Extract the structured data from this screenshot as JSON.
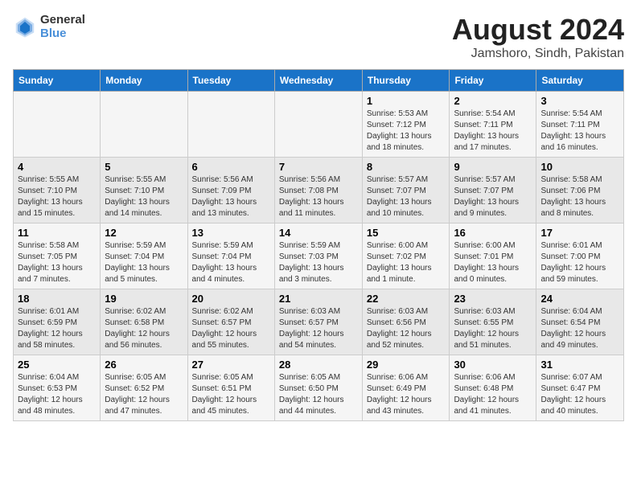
{
  "header": {
    "logo_line1": "General",
    "logo_line2": "Blue",
    "title": "August 2024",
    "subtitle": "Jamshoro, Sindh, Pakistan"
  },
  "days_of_week": [
    "Sunday",
    "Monday",
    "Tuesday",
    "Wednesday",
    "Thursday",
    "Friday",
    "Saturday"
  ],
  "weeks": [
    [
      {
        "day": "",
        "info": ""
      },
      {
        "day": "",
        "info": ""
      },
      {
        "day": "",
        "info": ""
      },
      {
        "day": "",
        "info": ""
      },
      {
        "day": "1",
        "info": "Sunrise: 5:53 AM\nSunset: 7:12 PM\nDaylight: 13 hours\nand 18 minutes."
      },
      {
        "day": "2",
        "info": "Sunrise: 5:54 AM\nSunset: 7:11 PM\nDaylight: 13 hours\nand 17 minutes."
      },
      {
        "day": "3",
        "info": "Sunrise: 5:54 AM\nSunset: 7:11 PM\nDaylight: 13 hours\nand 16 minutes."
      }
    ],
    [
      {
        "day": "4",
        "info": "Sunrise: 5:55 AM\nSunset: 7:10 PM\nDaylight: 13 hours\nand 15 minutes."
      },
      {
        "day": "5",
        "info": "Sunrise: 5:55 AM\nSunset: 7:10 PM\nDaylight: 13 hours\nand 14 minutes."
      },
      {
        "day": "6",
        "info": "Sunrise: 5:56 AM\nSunset: 7:09 PM\nDaylight: 13 hours\nand 13 minutes."
      },
      {
        "day": "7",
        "info": "Sunrise: 5:56 AM\nSunset: 7:08 PM\nDaylight: 13 hours\nand 11 minutes."
      },
      {
        "day": "8",
        "info": "Sunrise: 5:57 AM\nSunset: 7:07 PM\nDaylight: 13 hours\nand 10 minutes."
      },
      {
        "day": "9",
        "info": "Sunrise: 5:57 AM\nSunset: 7:07 PM\nDaylight: 13 hours\nand 9 minutes."
      },
      {
        "day": "10",
        "info": "Sunrise: 5:58 AM\nSunset: 7:06 PM\nDaylight: 13 hours\nand 8 minutes."
      }
    ],
    [
      {
        "day": "11",
        "info": "Sunrise: 5:58 AM\nSunset: 7:05 PM\nDaylight: 13 hours\nand 7 minutes."
      },
      {
        "day": "12",
        "info": "Sunrise: 5:59 AM\nSunset: 7:04 PM\nDaylight: 13 hours\nand 5 minutes."
      },
      {
        "day": "13",
        "info": "Sunrise: 5:59 AM\nSunset: 7:04 PM\nDaylight: 13 hours\nand 4 minutes."
      },
      {
        "day": "14",
        "info": "Sunrise: 5:59 AM\nSunset: 7:03 PM\nDaylight: 13 hours\nand 3 minutes."
      },
      {
        "day": "15",
        "info": "Sunrise: 6:00 AM\nSunset: 7:02 PM\nDaylight: 13 hours\nand 1 minute."
      },
      {
        "day": "16",
        "info": "Sunrise: 6:00 AM\nSunset: 7:01 PM\nDaylight: 13 hours\nand 0 minutes."
      },
      {
        "day": "17",
        "info": "Sunrise: 6:01 AM\nSunset: 7:00 PM\nDaylight: 12 hours\nand 59 minutes."
      }
    ],
    [
      {
        "day": "18",
        "info": "Sunrise: 6:01 AM\nSunset: 6:59 PM\nDaylight: 12 hours\nand 58 minutes."
      },
      {
        "day": "19",
        "info": "Sunrise: 6:02 AM\nSunset: 6:58 PM\nDaylight: 12 hours\nand 56 minutes."
      },
      {
        "day": "20",
        "info": "Sunrise: 6:02 AM\nSunset: 6:57 PM\nDaylight: 12 hours\nand 55 minutes."
      },
      {
        "day": "21",
        "info": "Sunrise: 6:03 AM\nSunset: 6:57 PM\nDaylight: 12 hours\nand 54 minutes."
      },
      {
        "day": "22",
        "info": "Sunrise: 6:03 AM\nSunset: 6:56 PM\nDaylight: 12 hours\nand 52 minutes."
      },
      {
        "day": "23",
        "info": "Sunrise: 6:03 AM\nSunset: 6:55 PM\nDaylight: 12 hours\nand 51 minutes."
      },
      {
        "day": "24",
        "info": "Sunrise: 6:04 AM\nSunset: 6:54 PM\nDaylight: 12 hours\nand 49 minutes."
      }
    ],
    [
      {
        "day": "25",
        "info": "Sunrise: 6:04 AM\nSunset: 6:53 PM\nDaylight: 12 hours\nand 48 minutes."
      },
      {
        "day": "26",
        "info": "Sunrise: 6:05 AM\nSunset: 6:52 PM\nDaylight: 12 hours\nand 47 minutes."
      },
      {
        "day": "27",
        "info": "Sunrise: 6:05 AM\nSunset: 6:51 PM\nDaylight: 12 hours\nand 45 minutes."
      },
      {
        "day": "28",
        "info": "Sunrise: 6:05 AM\nSunset: 6:50 PM\nDaylight: 12 hours\nand 44 minutes."
      },
      {
        "day": "29",
        "info": "Sunrise: 6:06 AM\nSunset: 6:49 PM\nDaylight: 12 hours\nand 43 minutes."
      },
      {
        "day": "30",
        "info": "Sunrise: 6:06 AM\nSunset: 6:48 PM\nDaylight: 12 hours\nand 41 minutes."
      },
      {
        "day": "31",
        "info": "Sunrise: 6:07 AM\nSunset: 6:47 PM\nDaylight: 12 hours\nand 40 minutes."
      }
    ]
  ]
}
